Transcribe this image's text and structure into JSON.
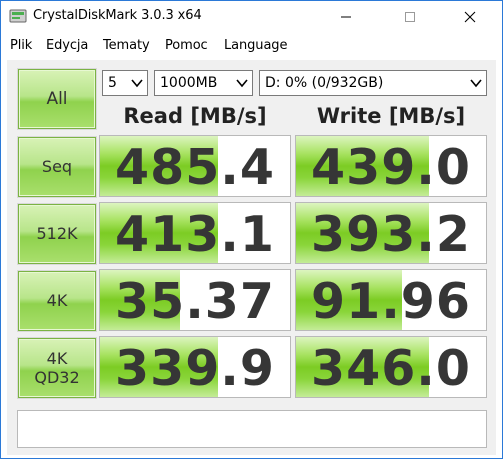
{
  "window": {
    "title": "CrystalDiskMark 3.0.3 x64",
    "accent": "#2b79d7"
  },
  "menu": [
    "Plik",
    "Edycja",
    "Tematy",
    "Pomoc",
    "Language"
  ],
  "controls": {
    "all_button": "All",
    "runs": "5",
    "size": "1000MB",
    "drive": "D: 0% (0/932GB)"
  },
  "headers": {
    "read": "Read [MB/s]",
    "write": "Write [MB/s]"
  },
  "rows": [
    {
      "label": "Seq",
      "read": "485.4",
      "write": "439.0",
      "read_level": 0.62,
      "write_level": 0.7
    },
    {
      "label": "512K",
      "read": "413.1",
      "write": "393.2",
      "read_level": 0.62,
      "write_level": 0.7
    },
    {
      "label": "4K",
      "read": "35.37",
      "write": "91.96",
      "read_level": 0.42,
      "write_level": 0.56
    },
    {
      "label": "4K\nQD32",
      "read": "339.9",
      "write": "346.0",
      "read_level": 0.62,
      "write_level": 0.7
    }
  ],
  "status": "",
  "colors": {
    "bar_green": "#7ccc24",
    "button_green": "#a9df6d"
  }
}
